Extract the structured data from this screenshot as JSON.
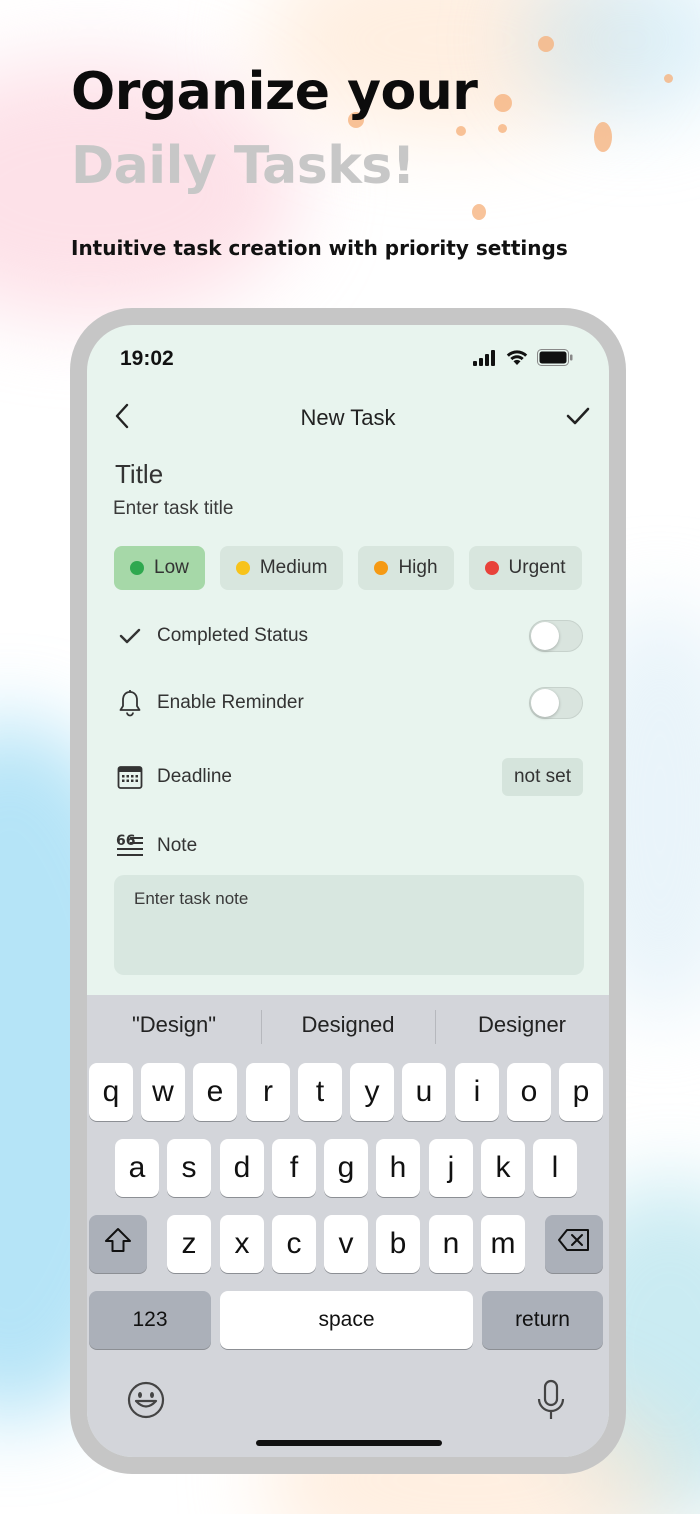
{
  "promo": {
    "headline_line1": "Organize your",
    "headline_line2": "Daily Tasks!",
    "subheadline": "Intuitive task creation with priority settings"
  },
  "status_bar": {
    "time": "19:02",
    "icons": [
      "cellular-signal-icon",
      "wifi-icon",
      "battery-icon"
    ]
  },
  "nav": {
    "back_icon": "chevron-left-icon",
    "title": "New Task",
    "done_icon": "checkmark-icon"
  },
  "form": {
    "title_label": "Title",
    "title_placeholder": "Enter task title",
    "priorities": [
      {
        "label": "Low",
        "color": "#2fa84f",
        "selected": true
      },
      {
        "label": "Medium",
        "color": "#f7c31a",
        "selected": false
      },
      {
        "label": "High",
        "color": "#f59a14",
        "selected": false
      },
      {
        "label": "Urgent",
        "color": "#e8423a",
        "selected": false
      }
    ],
    "completed": {
      "label": "Completed Status",
      "icon": "checkmark-icon",
      "on": false
    },
    "reminder": {
      "label": "Enable Reminder",
      "icon": "bell-icon",
      "on": false
    },
    "deadline": {
      "label": "Deadline",
      "icon": "calendar-icon",
      "value": "not set"
    },
    "note": {
      "label": "Note",
      "icon": "quote-text-icon",
      "placeholder": "Enter task note"
    }
  },
  "keyboard": {
    "suggestions": [
      "\"Design\"",
      "Designed",
      "Designer"
    ],
    "row1": [
      "q",
      "w",
      "e",
      "r",
      "t",
      "y",
      "u",
      "i",
      "o",
      "p"
    ],
    "row2": [
      "a",
      "s",
      "d",
      "f",
      "g",
      "h",
      "j",
      "k",
      "l"
    ],
    "row3": [
      "z",
      "x",
      "c",
      "v",
      "b",
      "n",
      "m"
    ],
    "numbers_label": "123",
    "space_label": "space",
    "return_label": "return",
    "shift_icon": "shift-icon",
    "delete_icon": "delete-icon",
    "emoji_icon": "emoji-icon",
    "mic_icon": "microphone-icon"
  },
  "colors": {
    "screen_bg": "#e8f4ee",
    "chip_bg": "#d8e6de",
    "chip_selected_bg": "#a6d8a8",
    "frame": "#c6c6c6",
    "headline_secondary": "#c7c7c7"
  }
}
